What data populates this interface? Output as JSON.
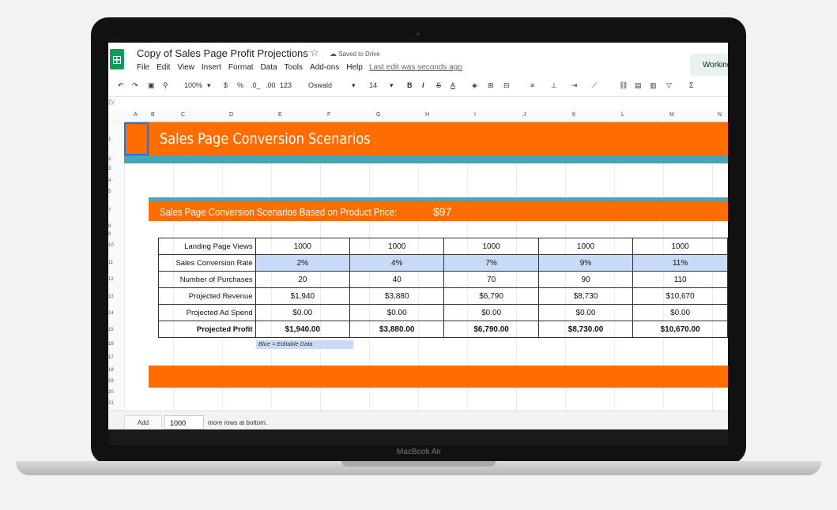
{
  "document": {
    "title": "Copy of Sales Page Profit Projections",
    "saved_status": "Saved to Drive",
    "last_edit": "Last edit was seconds ago",
    "working_label": "Working"
  },
  "menu": [
    "File",
    "Edit",
    "View",
    "Insert",
    "Format",
    "Data",
    "Tools",
    "Add-ons",
    "Help"
  ],
  "toolbar": {
    "zoom": "100%",
    "currency": "$",
    "percent": "%",
    "decimal_decrease": ".0_",
    "decimal_increase": ".00",
    "more_formats": "123",
    "font": "Oswald",
    "font_size": "14",
    "bold": "B",
    "italic": "I",
    "strike": "S",
    "text_color": "A"
  },
  "columns": [
    "A",
    "B",
    "C",
    "D",
    "E",
    "F",
    "G",
    "H",
    "I",
    "J",
    "K",
    "L",
    "M",
    "N"
  ],
  "rows": [
    "1",
    "2",
    "3",
    "4",
    "5",
    "7",
    "8",
    "9",
    "10",
    "11",
    "12",
    "13",
    "14",
    "15",
    "16",
    "17",
    "18",
    "19",
    "20",
    "21"
  ],
  "sheet": {
    "banner_title": "Sales Page Conversion Scenarios",
    "subtitle": "Sales Page Conversion Scenarios Based on Product Price:",
    "price": "$97",
    "legend": "Blue = Editable Data",
    "accent_color": "#ff6d00",
    "teal_color": "#4ba3b3",
    "editable_color": "#c9daf8"
  },
  "table": {
    "rows": [
      {
        "label": "Landing Page Views",
        "values": [
          "1000",
          "1000",
          "1000",
          "1000",
          "1000"
        ]
      },
      {
        "label": "Sales Conversion Rate",
        "values": [
          "2%",
          "4%",
          "7%",
          "9%",
          "11%"
        ]
      },
      {
        "label": "Number of Purchases",
        "values": [
          "20",
          "40",
          "70",
          "90",
          "110"
        ]
      },
      {
        "label": "Projected Revenue",
        "values": [
          "$1,940",
          "$3,880",
          "$6,790",
          "$8,730",
          "$10,670"
        ]
      },
      {
        "label": "Projected Ad Spend",
        "values": [
          "$0.00",
          "$0.00",
          "$0.00",
          "$0.00",
          "$0.00"
        ]
      },
      {
        "label": "Projected Profit",
        "values": [
          "$1,940.00",
          "$3,880.00",
          "$6,790.00",
          "$8,730.00",
          "$10,670.00"
        ]
      }
    ]
  },
  "bottom": {
    "add_label": "Add",
    "rows_value": "1000",
    "more_rows_text": "more rows at bottom."
  },
  "device_label": "MacBook Air"
}
